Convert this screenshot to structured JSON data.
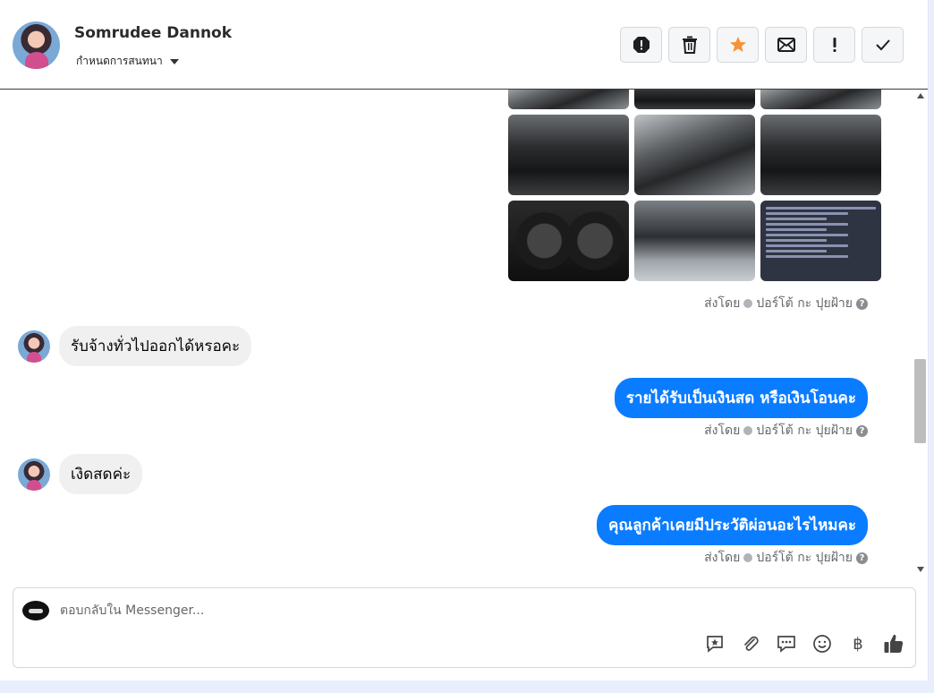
{
  "header": {
    "contact_name": "Somrudee Dannok",
    "conversation_settings_label": "กำหนดการสนทนา",
    "actions": [
      "report-icon",
      "trash-icon",
      "star-icon",
      "mail-icon",
      "exclamation-icon",
      "check-icon"
    ],
    "accent_star_color": "#f7923a"
  },
  "sent_by": {
    "prefix": "ส่งโดย",
    "agent": "ปอร์โต้ กะ ปุยฝ้าย"
  },
  "messages": [
    {
      "from": "customer",
      "text": "รับจ้างทั่วไปออกได้หรอคะ"
    },
    {
      "from": "page",
      "text": "รายได้รับเป็นเงินสด หรือเงินโอนคะ"
    },
    {
      "from": "customer",
      "text": "เงิดสดค่ะ"
    },
    {
      "from": "page",
      "text": "คุณลูกค้าเคยมีประวัติผ่อนอะไรไหมคะ"
    }
  ],
  "composer": {
    "placeholder": "ตอบกลับใน Messenger...",
    "tools": [
      "saved-reply-icon",
      "attachment-icon",
      "chat-bubble-icon",
      "emoji-icon",
      "baht-icon",
      "thumbs-up-icon"
    ],
    "baht_symbol": "฿"
  },
  "colors": {
    "outgoing_bubble": "#0a7cff",
    "incoming_bubble": "#f0f0f0"
  }
}
